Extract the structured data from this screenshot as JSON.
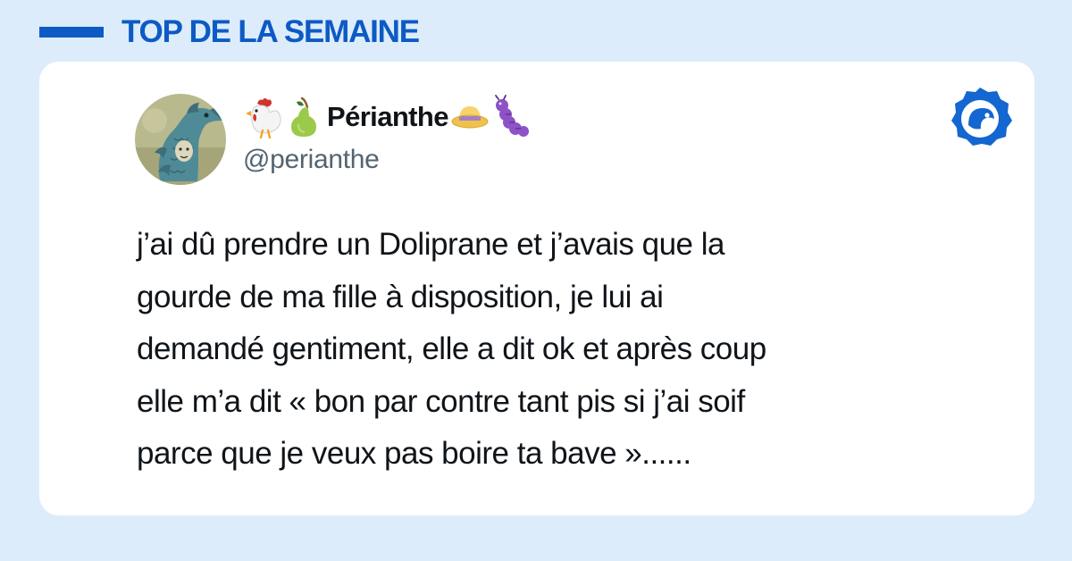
{
  "header": {
    "title": "TOP DE LA SEMAINE",
    "accent_color": "#0d5ac4"
  },
  "tweet": {
    "display_name": "Périanthe",
    "handle": "@perianthe",
    "name_emojis_before": [
      "rooster-emoji",
      "pear-emoji"
    ],
    "name_emojis_after": [
      "straw-hat-emoji",
      "caterpillar-emoji"
    ],
    "text_lines": [
      "j’ai dû prendre un Doliprane et j’avais que la",
      "gourde de ma fille à disposition, je lui ai",
      "demandé gentiment, elle a dit ok et après coup",
      "elle m’a dit « bon par contre tant pis si j’ai soif",
      "parce que je veux pas boire ta bave »......"
    ]
  },
  "colors": {
    "page_background": "#dcecfb",
    "card_background": "#ffffff",
    "text_primary": "#0f1419",
    "text_secondary": "#536471",
    "brand": "#0d5ac4"
  },
  "icons": {
    "logo": "brand-bird-logo-icon",
    "avatar": "dragon-avatar"
  }
}
